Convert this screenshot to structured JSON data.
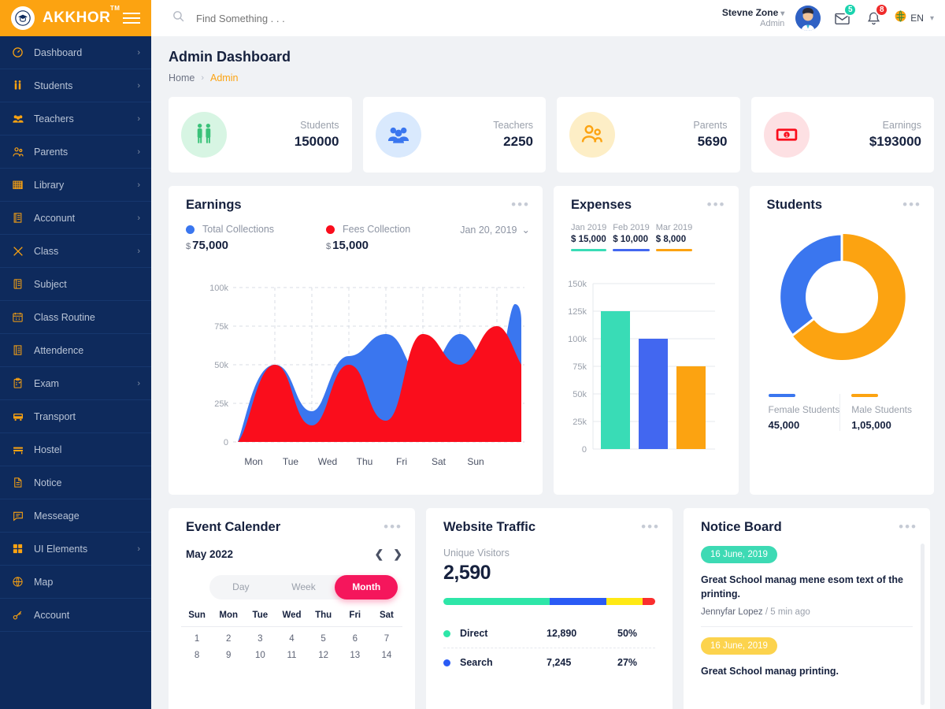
{
  "brand": {
    "name": "AKKHOR",
    "tm": "TM",
    "logo_icon": "graduation-cap-icon",
    "menu_toggle_icon": "hamburger-icon"
  },
  "sidebar": {
    "items": [
      {
        "label": "Dashboard",
        "icon": "speedometer-icon",
        "arrow": "›",
        "has_arrow": true
      },
      {
        "label": "Students",
        "icon": "students-pair-icon",
        "arrow": "›",
        "has_arrow": true
      },
      {
        "label": "Teachers",
        "icon": "teachers-group-icon",
        "arrow": "›",
        "has_arrow": true
      },
      {
        "label": "Parents",
        "icon": "parents-icon",
        "arrow": "›",
        "has_arrow": true
      },
      {
        "label": "Library",
        "icon": "library-icon",
        "arrow": "›",
        "has_arrow": true
      },
      {
        "label": "Acconunt",
        "icon": "account-book-icon",
        "arrow": "›",
        "has_arrow": true
      },
      {
        "label": "Class",
        "icon": "pencil-ruler-icon",
        "arrow": "›",
        "has_arrow": true
      },
      {
        "label": "Subject",
        "icon": "subject-icon",
        "arrow": "",
        "has_arrow": false
      },
      {
        "label": "Class Routine",
        "icon": "calendar-icon",
        "arrow": "",
        "has_arrow": false
      },
      {
        "label": "Attendence",
        "icon": "attendance-icon",
        "arrow": "",
        "has_arrow": false
      },
      {
        "label": "Exam",
        "icon": "clipboard-icon",
        "arrow": "›",
        "has_arrow": true
      },
      {
        "label": "Transport",
        "icon": "bus-icon",
        "arrow": "",
        "has_arrow": false
      },
      {
        "label": "Hostel",
        "icon": "bed-icon",
        "arrow": "",
        "has_arrow": false
      },
      {
        "label": "Notice",
        "icon": "notice-document-icon",
        "arrow": "",
        "has_arrow": false
      },
      {
        "label": "Messeage",
        "icon": "chat-bubble-icon",
        "arrow": "",
        "has_arrow": false
      },
      {
        "label": "UI Elements",
        "icon": "grid-squares-icon",
        "arrow": "›",
        "has_arrow": true
      },
      {
        "label": "Map",
        "icon": "globe-map-icon",
        "arrow": "",
        "has_arrow": false
      },
      {
        "label": "Account",
        "icon": "key-icon",
        "arrow": "",
        "has_arrow": false
      }
    ]
  },
  "header": {
    "search_placeholder": "Find Something . . .",
    "search_value": "",
    "search_icon": "search-icon",
    "user_name": "Stevne Zone",
    "user_role": "Admin",
    "mail_icon": "envelope-icon",
    "mail_count": "5",
    "bell_icon": "bell-icon",
    "bell_count": "8",
    "lang_icon": "globe-icon",
    "lang": "EN"
  },
  "page": {
    "title": "Admin Dashboard",
    "breadcrumb": {
      "home": "Home",
      "sep": "›",
      "current": "Admin"
    }
  },
  "stats": [
    {
      "label": "Students",
      "value": "150000",
      "icon": "students-pair-icon",
      "bg": "#d7f5e3",
      "fg": "#3ac279"
    },
    {
      "label": "Teachers",
      "value": "2250",
      "icon": "teachers-group-icon",
      "bg": "#d9e9fd",
      "fg": "#3a76ef"
    },
    {
      "label": "Parents",
      "value": "5690",
      "icon": "parents-icon",
      "bg": "#fdeec6",
      "fg": "#fca311"
    },
    {
      "label": "Earnings",
      "value": "$193000",
      "icon": "money-note-icon",
      "bg": "#fde0e3",
      "fg": "#fa0d1c"
    }
  ],
  "earnings": {
    "title": "Earnings",
    "date_label": "Jan 20, 2019",
    "chevron_icon": "chevron-down-icon",
    "menu_icon": "dots-menu-icon",
    "legend": [
      {
        "name": "Total Collections",
        "value": "75,000",
        "currency": "$",
        "color": "#3a76ef"
      },
      {
        "name": "Fees Collection",
        "value": "15,000",
        "currency": "$",
        "color": "#fa0d1c"
      }
    ]
  },
  "expenses": {
    "title": "Expenses",
    "menu_icon": "dots-menu-icon",
    "months": [
      {
        "label": "Jan 2019",
        "value": "$ 15,000",
        "color": "#39dcb6"
      },
      {
        "label": "Feb 2019",
        "value": "$ 10,000",
        "color": "#4267f0"
      },
      {
        "label": "Mar 2019",
        "value": "$ 8,000",
        "color": "#fca311"
      }
    ]
  },
  "students_card": {
    "title": "Students",
    "menu_icon": "dots-menu-icon",
    "legend": [
      {
        "name": "Female Students",
        "value": "45,000",
        "color": "#3a76ef"
      },
      {
        "name": "Male Students",
        "value": "1,05,000",
        "color": "#fca311"
      }
    ]
  },
  "calendar": {
    "title": "Event Calender",
    "menu_icon": "dots-menu-icon",
    "month_label": "May 2022",
    "prev_icon": "chevron-left-icon",
    "next_icon": "chevron-right-icon",
    "views": [
      {
        "label": "Day",
        "active": false
      },
      {
        "label": "Week",
        "active": false
      },
      {
        "label": "Month",
        "active": true
      }
    ],
    "day_headers": [
      "Sun",
      "Mon",
      "Tue",
      "Wed",
      "Thu",
      "Fri",
      "Sat"
    ],
    "weeks": [
      [
        "1",
        "2",
        "3",
        "4",
        "5",
        "6",
        "7"
      ],
      [
        "8",
        "9",
        "10",
        "11",
        "12",
        "13",
        "14"
      ]
    ]
  },
  "traffic": {
    "title": "Website Traffic",
    "menu_icon": "dots-menu-icon",
    "subtitle": "Unique Visitors",
    "total": "2,590",
    "rows": [
      {
        "name": "Direct",
        "value": "12,890",
        "pct": "50%",
        "color": "#2ee6a8"
      },
      {
        "name": "Search",
        "value": "7,245",
        "pct": "27%",
        "color": "#2a5bf5"
      }
    ],
    "bar_segments": [
      {
        "color": "#2ee6a8",
        "width": "50%"
      },
      {
        "color": "#2a5bf5",
        "width": "27%"
      },
      {
        "color": "#ffe914",
        "width": "17%"
      },
      {
        "color": "#fa2e2e",
        "width": "6%"
      }
    ]
  },
  "notice": {
    "title": "Notice Board",
    "menu_icon": "dots-menu-icon",
    "items": [
      {
        "date": "16 June, 2019",
        "date_color": "#3ddab4",
        "text": "Great School manag mene esom text of the printing.",
        "author": "Jennyfar Lopez",
        "time": "5 min ago"
      },
      {
        "date": "16 June, 2019",
        "date_color": "#fcd34d",
        "text": "Great School manag printing.",
        "author": "",
        "time": ""
      }
    ]
  },
  "chart_data": [
    {
      "type": "area",
      "title": "Earnings",
      "categories": [
        "Mon",
        "Tue",
        "Wed",
        "Thu",
        "Fri",
        "Sat",
        "Sun"
      ],
      "series": [
        {
          "name": "Total Collections",
          "color": "#3a76ef",
          "values": [
            50,
            20,
            57,
            70,
            70,
            50,
            90
          ]
        },
        {
          "name": "Fees Collection",
          "color": "#fa0d1c",
          "values": [
            50,
            10,
            50,
            14,
            70,
            50,
            75
          ]
        }
      ],
      "ylabel": "",
      "xlabel": "",
      "ytick_labels": [
        "0",
        "25k",
        "50k",
        "75k",
        "100k"
      ],
      "ylim": [
        0,
        100
      ],
      "grid": true,
      "legend_position": "top-left"
    },
    {
      "type": "bar",
      "title": "Expenses",
      "categories": [
        "Jan 2019",
        "Feb 2019",
        "Mar 2019"
      ],
      "values": [
        125,
        100,
        75
      ],
      "colors": [
        "#39dcb6",
        "#4267f0",
        "#fca311"
      ],
      "ytick_labels": [
        "0",
        "25k",
        "50k",
        "75k",
        "100k",
        "125k",
        "150k"
      ],
      "ylim": [
        0,
        150
      ],
      "grid": true,
      "legend_position": "none"
    },
    {
      "type": "pie",
      "title": "Students",
      "categories": [
        "Female Students",
        "Male Students"
      ],
      "values": [
        45000,
        105000
      ],
      "colors": [
        "#3a76ef",
        "#fca311"
      ],
      "legend_position": "bottom"
    }
  ]
}
